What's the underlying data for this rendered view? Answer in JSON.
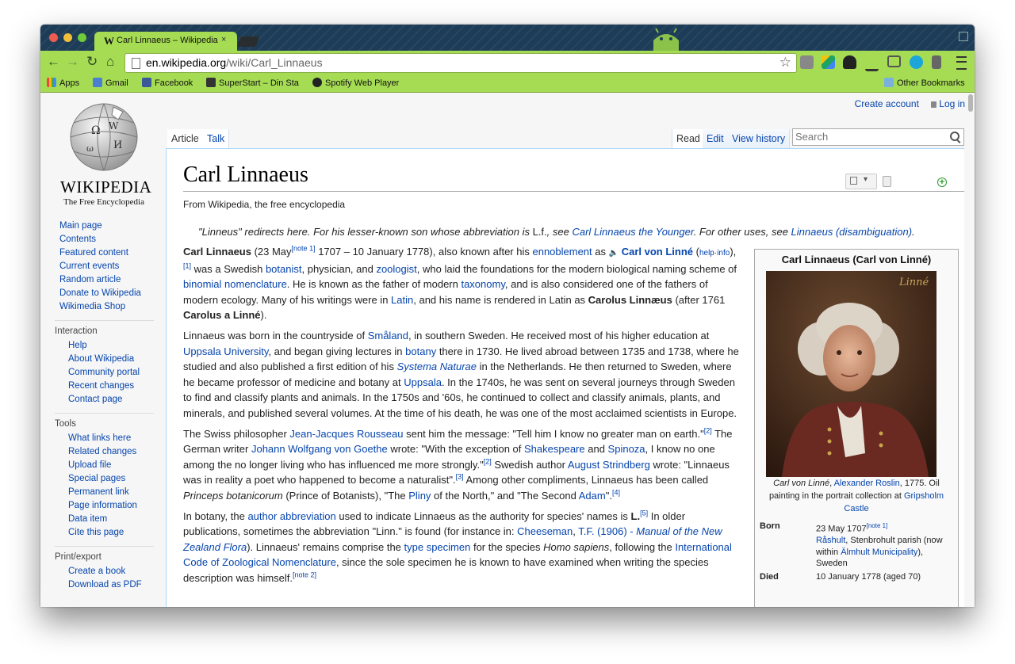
{
  "browser": {
    "tab_title": "Carl Linnaeus – Wikipedia, the free encyclopedia",
    "tab_close": "×",
    "favicon": "W",
    "url_host": "en.wikipedia.org",
    "url_path": "/wiki/Carl_Linnaeus",
    "bookmarks": [
      "Apps",
      "Gmail",
      "Facebook",
      "SuperStart – Din Star",
      "Spotify Web Player"
    ],
    "other_bookmarks": "Other Bookmarks",
    "icons": [
      "back-icon",
      "forward-icon",
      "reload-icon",
      "home-icon",
      "star-icon",
      "menu-icon"
    ]
  },
  "wiki": {
    "personal": {
      "create_account": "Create account",
      "login": "Log in"
    },
    "logo": {
      "wordmark": "WIKIPEDIA",
      "tagline": "The Free Encyclopedia"
    },
    "nav": [
      "Main page",
      "Contents",
      "Featured content",
      "Current events",
      "Random article",
      "Donate to Wikipedia",
      "Wikimedia Shop"
    ],
    "interaction": {
      "title": "Interaction",
      "items": [
        "Help",
        "About Wikipedia",
        "Community portal",
        "Recent changes",
        "Contact page"
      ]
    },
    "tools": {
      "title": "Tools",
      "items": [
        "What links here",
        "Related changes",
        "Upload file",
        "Special pages",
        "Permanent link",
        "Page information",
        "Data item",
        "Cite this page"
      ]
    },
    "print": {
      "title": "Print/export",
      "items": [
        "Create a book",
        "Download as PDF"
      ]
    },
    "tabs": {
      "article": "Article",
      "talk": "Talk",
      "read": "Read",
      "edit": "Edit",
      "history": "View history"
    },
    "search_placeholder": "Search"
  },
  "article": {
    "title": "Carl Linnaeus",
    "from": "From Wikipedia, the free encyclopedia",
    "hatnote": {
      "t1": "\"Linneus\" redirects here. For his lesser-known son whose abbreviation is ",
      "t2": "L.f.",
      "t3": ", see ",
      "l1": "Carl Linnaeus the Younger",
      "t4": ". For other uses, see ",
      "l2": "Linnaeus (disambiguation)",
      "t5": "."
    },
    "p1": {
      "b1": "Carl Linnaeus",
      "t1": " (23 May",
      "n1": "[note 1]",
      "t2": " 1707 – 10 January 1778), also known after his ",
      "l1": "ennoblement",
      "t3": " as ",
      "b2": "Carl von Linné",
      "t4": " (",
      "l2": "help·info",
      "t5": "),",
      "n2": "[1]",
      "t6": " was a Swedish ",
      "l3": "botanist",
      "t7": ", physician, and ",
      "l4": "zoologist",
      "t8": ", who laid the foundations for the modern biological naming scheme of ",
      "l5": "binomial nomenclature",
      "t9": ". He is known as the father of modern ",
      "l6": "taxonomy",
      "t10": ", and is also considered one of the fathers of modern ecology. Many of his writings were in ",
      "l7": "Latin",
      "t11": ", and his name is rendered in Latin as ",
      "b3": "Carolus Linnæus",
      "t12": " (after 1761 ",
      "b4": "Carolus a Linné",
      "t13": ")."
    },
    "p2": {
      "t1": "Linnaeus was born in the countryside of ",
      "l1": "Småland",
      "t2": ", in southern Sweden. He received most of his higher education at ",
      "l2": "Uppsala University",
      "t3": ", and began giving lectures in ",
      "l3": "botany",
      "t4": " there in 1730. He lived abroad between 1735 and 1738, where he studied and also published a first edition of his ",
      "l4": "Systema Naturae",
      "t5": " in the Netherlands. He then returned to Sweden, where he became professor of medicine and botany at ",
      "l5": "Uppsala",
      "t6": ". In the 1740s, he was sent on several journeys through Sweden to find and classify plants and animals. In the 1750s and '60s, he continued to collect and classify animals, plants, and minerals, and published several volumes. At the time of his death, he was one of the most acclaimed scientists in Europe."
    },
    "p3": {
      "t1": "The Swiss philosopher ",
      "l1": "Jean-Jacques Rousseau",
      "t2": " sent him the message: \"Tell him I know no greater man on earth.\"",
      "r1": "[2]",
      "t3": " The German writer ",
      "l2": "Johann Wolfgang von Goethe",
      "t4": " wrote: \"With the exception of ",
      "l3": "Shakespeare",
      "t5": " and ",
      "l4": "Spinoza",
      "t6": ", I know no one among the no longer living who has influenced me more strongly.\"",
      "r2": "[2]",
      "t7": " Swedish author ",
      "l5": "August Strindberg",
      "t8": " wrote: \"Linnaeus was in reality a poet who happened to become a naturalist\".",
      "r3": "[3]",
      "t9": " Among other compliments, Linnaeus has been called ",
      "i1": "Princeps botanicorum",
      "t10": " (Prince of Botanists), \"The ",
      "l6": "Pliny",
      "t11": " of the North,\" and \"The Second ",
      "l7": "Adam",
      "t12": "\".",
      "r4": "[4]"
    },
    "p4": {
      "t1": "In botany, the ",
      "l1": "author abbreviation",
      "t2": " used to indicate Linnaeus as the authority for species' names is ",
      "b1": "L.",
      "r1": "[5]",
      "t3": " In older publications, sometimes the abbreviation \"Linn.\" is found (for instance in: ",
      "l2": "Cheeseman",
      "t4": ", ",
      "l3": "T.F. (1906) - ",
      "l4": "Manual of the New Zealand Flora",
      "t5": "). Linnaeus' remains comprise the ",
      "l5": "type specimen",
      "t6": " for the species ",
      "i1": "Homo sapiens",
      "t7": ", following the ",
      "l6": "International Code of Zoological Nomenclature",
      "t8": ", since the sole specimen he is known to have examined when writing the species description was ",
      "t9": "himself.",
      "n1": "[note 2]"
    }
  },
  "infobox": {
    "title": "Carl Linnaeus (Carl von Linné)",
    "signature": "Linné",
    "caption": {
      "i1": "Carl von Linné",
      "t1": ", ",
      "l1": "Alexander Roslin",
      "t2": ", 1775. Oil painting in the portrait collection at ",
      "l2": "Gripsholm Castle"
    },
    "born": {
      "label": "Born",
      "date": "23 May 1707",
      "note": "[note 1]",
      "l1": "Råshult",
      "t1": ", Stenbrohult parish (now within ",
      "l2": "Älmhult Municipality",
      "t2": "), Sweden"
    },
    "died": {
      "label": "Died",
      "date": "10 January 1778 (aged 70)"
    }
  }
}
